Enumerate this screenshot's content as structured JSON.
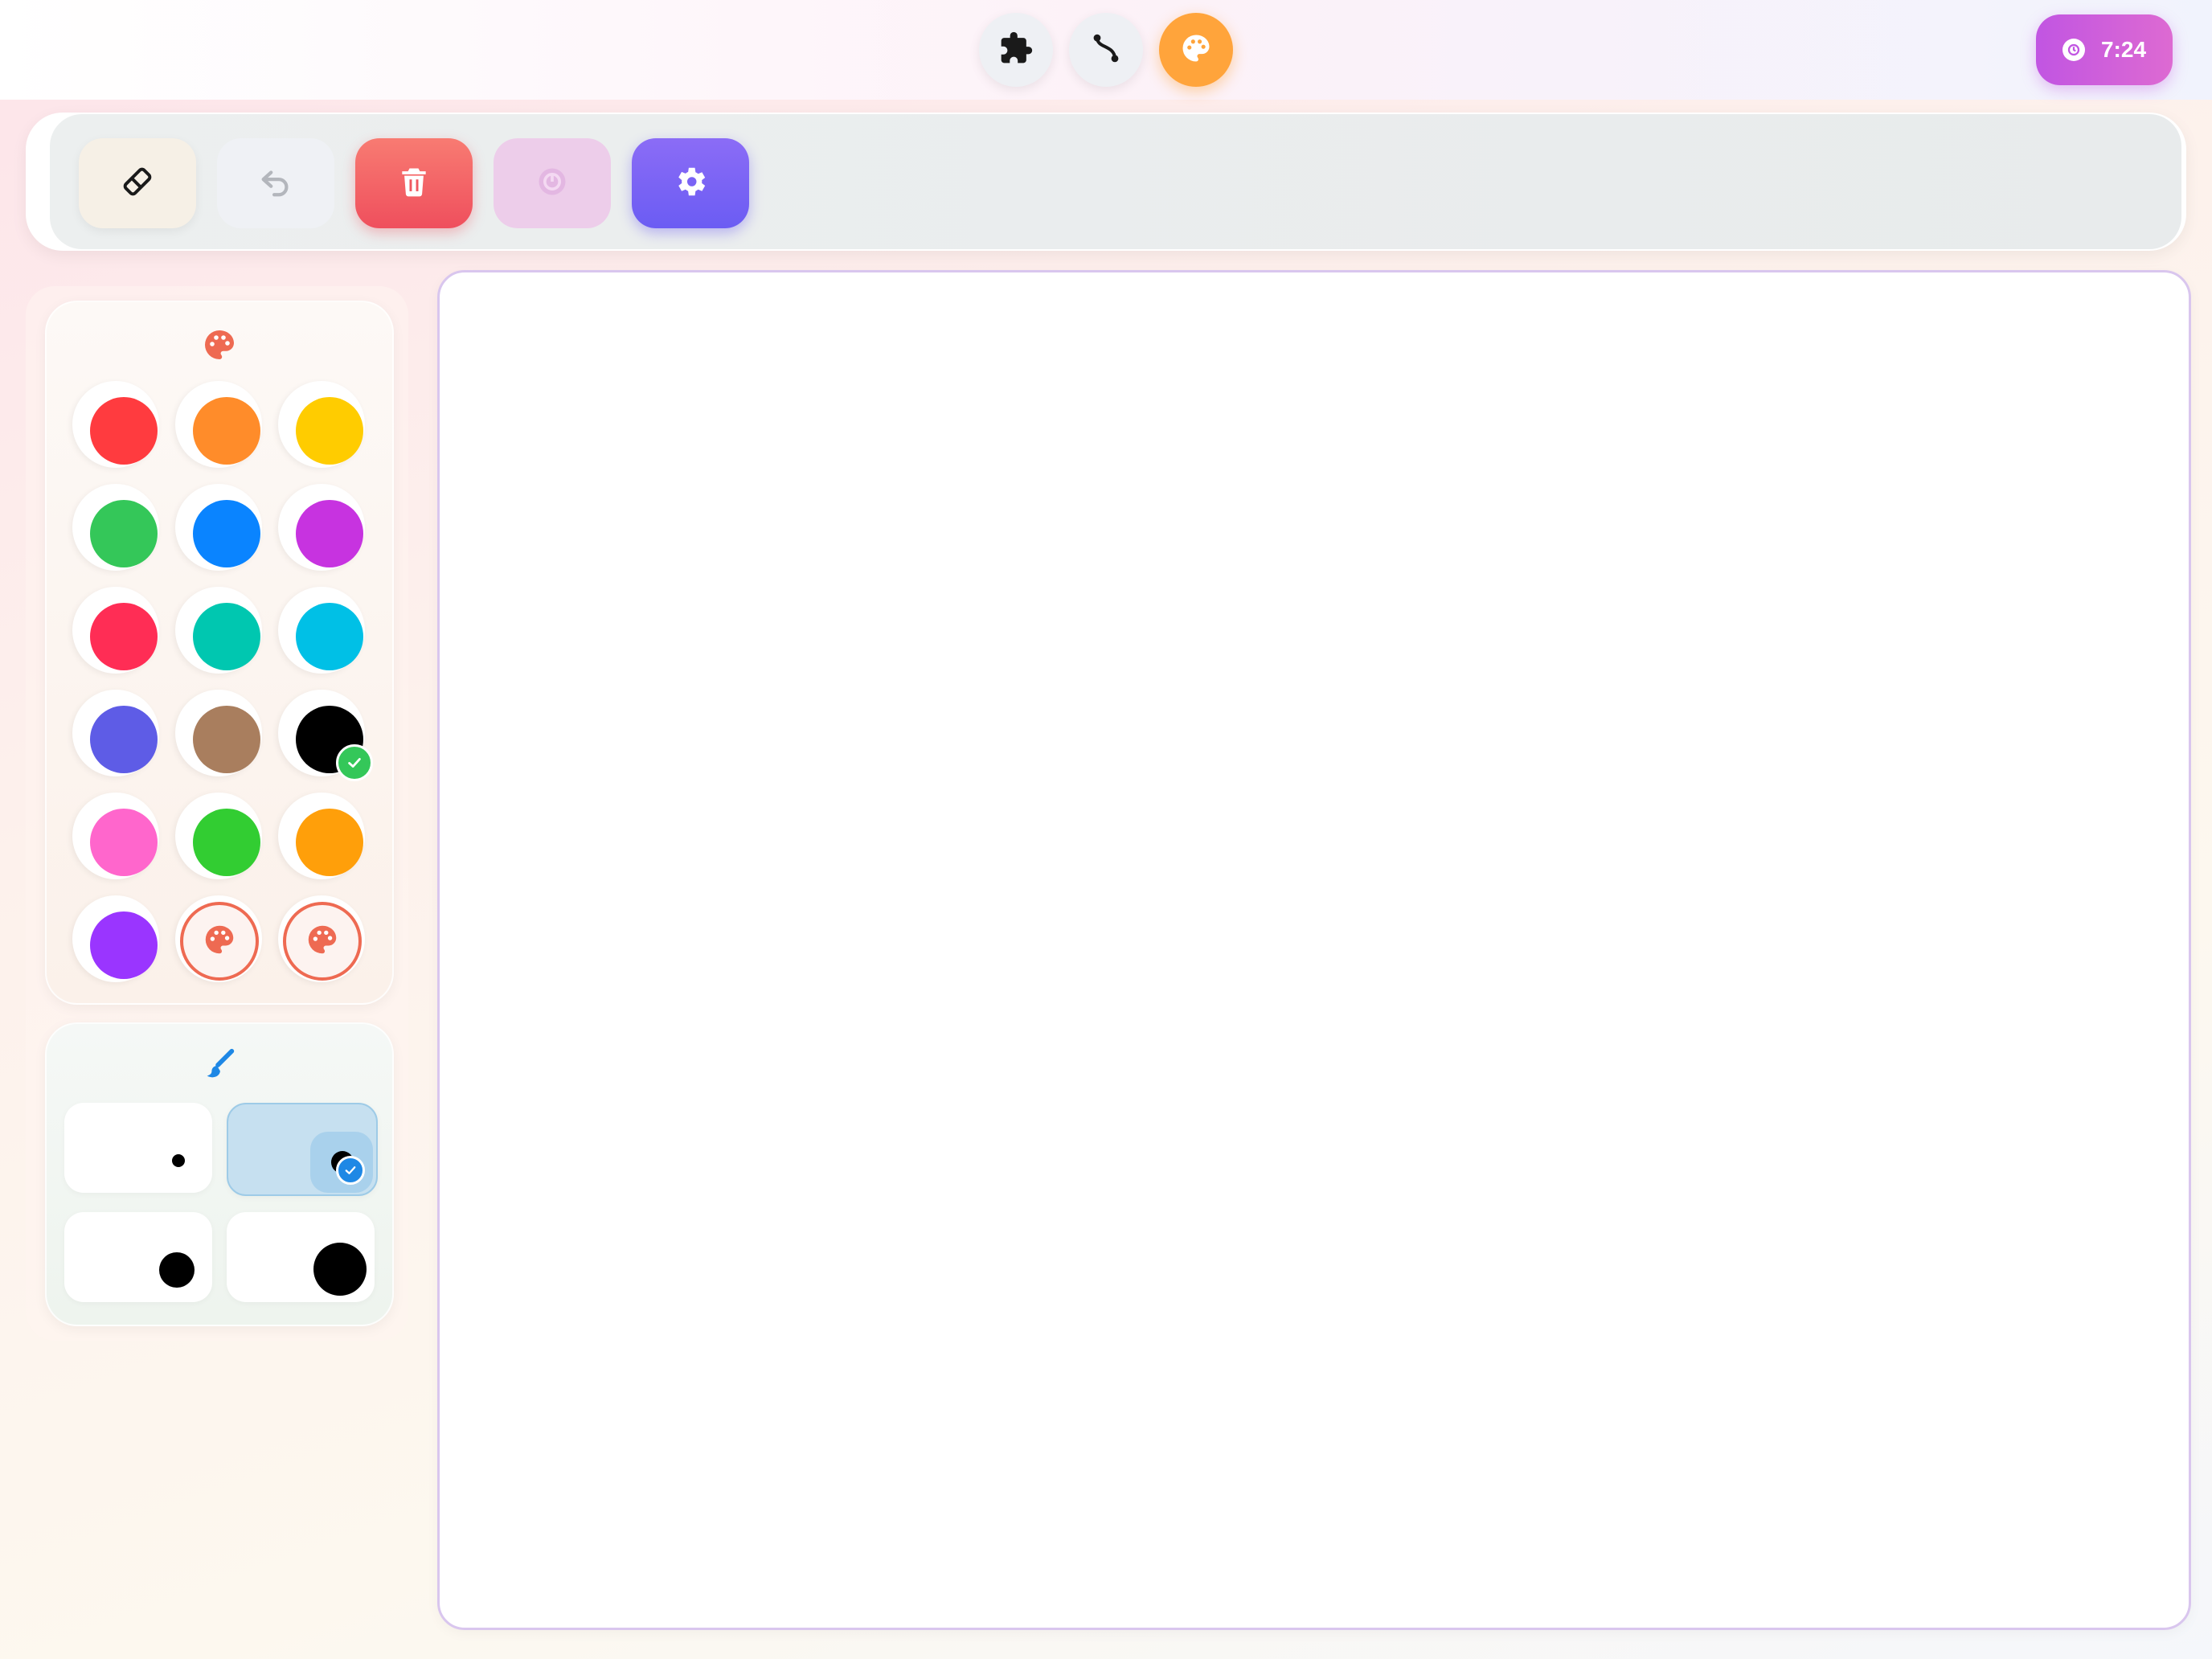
{
  "app": {
    "modes": [
      {
        "name": "puzzle",
        "icon": "puzzle-icon",
        "active": false
      },
      {
        "name": "path",
        "icon": "path-icon",
        "active": false
      },
      {
        "name": "paint",
        "icon": "palette-icon",
        "active": true
      }
    ],
    "timer": {
      "value": "7:24",
      "icon": "timer-icon"
    }
  },
  "toolbar": {
    "tools": [
      {
        "name": "eraser",
        "icon": "eraser-icon"
      },
      {
        "name": "undo",
        "icon": "undo-icon",
        "disabled": true
      },
      {
        "name": "clear",
        "icon": "trash-icon"
      },
      {
        "name": "stamp",
        "icon": "stamp-icon",
        "disabled": true
      },
      {
        "name": "settings",
        "icon": "gear-icon"
      }
    ]
  },
  "palette": {
    "header_icon": "palette-icon",
    "colors": [
      "#ff3b3f",
      "#ff8c2a",
      "#ffcc00",
      "#34c759",
      "#0a84ff",
      "#c733e0",
      "#ff2d55",
      "#00c7b0",
      "#00c0e6",
      "#5e5ce6",
      "#a97e5e",
      "#000000",
      "#ff66cc",
      "#32cd32",
      "#ff9f0a",
      "#9a35ff"
    ],
    "selected": "#000000",
    "custom_slots": 2
  },
  "brush": {
    "header_icon": "brush-icon",
    "sizes": [
      "small",
      "medium",
      "large",
      "xlarge"
    ],
    "selected": "medium"
  }
}
